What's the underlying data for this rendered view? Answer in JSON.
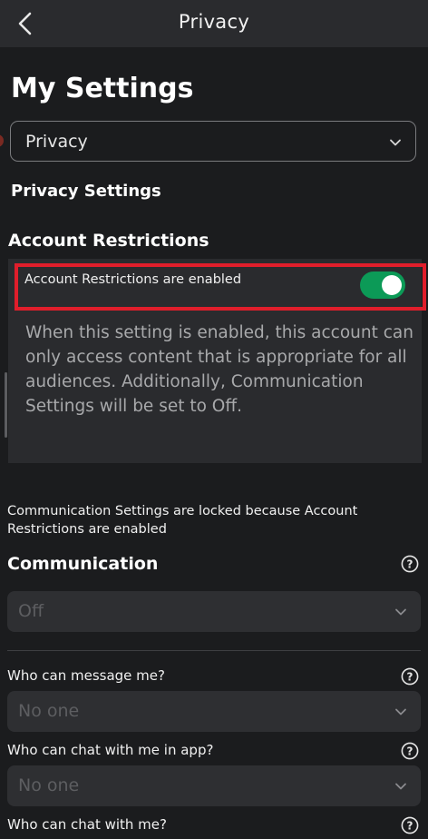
{
  "header": {
    "title": "Privacy"
  },
  "page": {
    "title": "My Settings"
  },
  "section_select": {
    "value": "Privacy"
  },
  "privacy_settings": {
    "heading": "Privacy Settings"
  },
  "account_restrictions": {
    "heading": "Account Restrictions",
    "toggle_label": "Account Restrictions are enabled",
    "toggle_on": true,
    "description": "When this setting is enabled, this account can only access content that is appropriate for all audiences. Additionally, Communication Settings will be set to Off."
  },
  "communication": {
    "locked_note": "Communication Settings are locked because Account Restrictions are enabled",
    "heading": "Communication",
    "value": "Off",
    "questions": [
      {
        "label": "Who can message me?",
        "value": "No one"
      },
      {
        "label": "Who can chat with me in app?",
        "value": "No one"
      },
      {
        "label": "Who can chat with me?"
      }
    ]
  },
  "colors": {
    "toggle_on": "#0c9a57",
    "highlight": "#e01e2b",
    "background": "#1b1c1e"
  },
  "icons": {
    "back": "chevron-left-icon",
    "dropdown": "chevron-down-icon",
    "help": "question-circle-icon"
  }
}
